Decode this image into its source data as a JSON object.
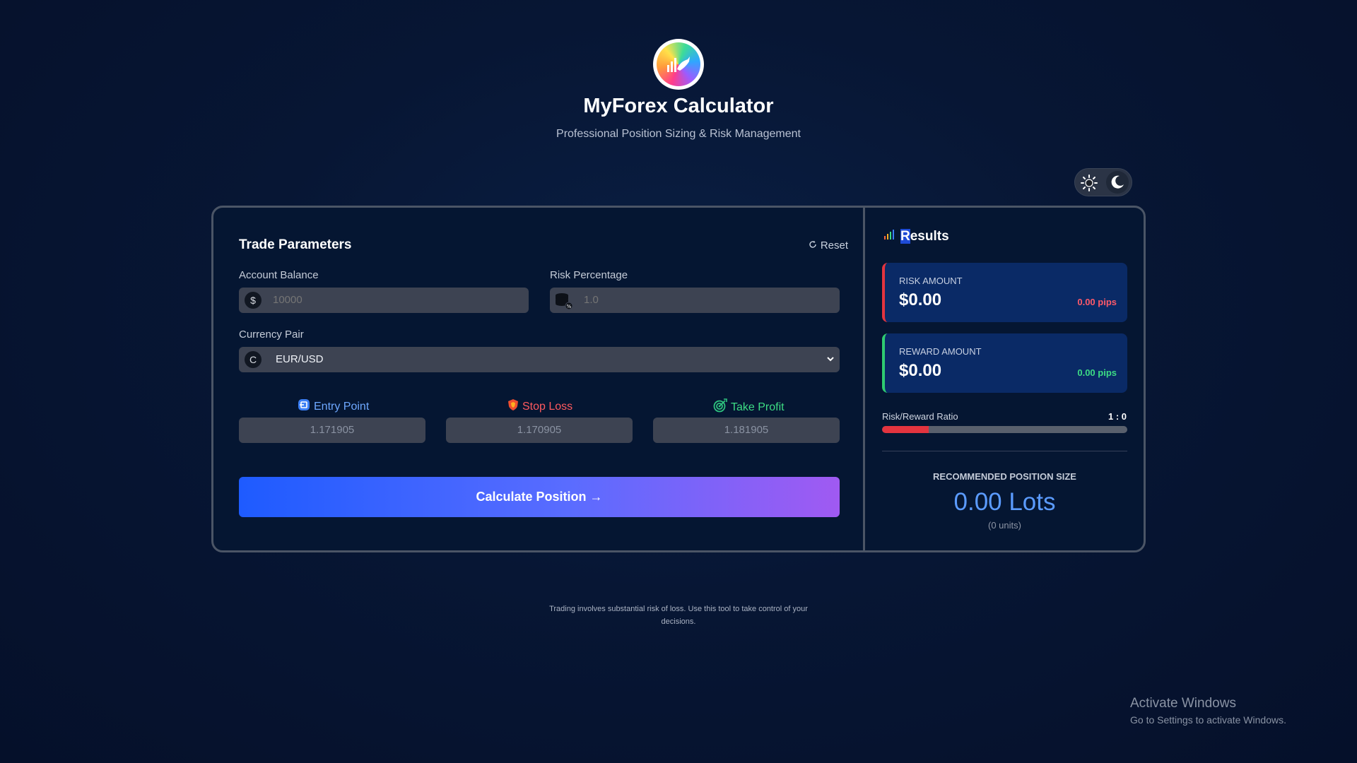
{
  "app": {
    "title": "MyForex Calculator",
    "subtitle": "Professional Position Sizing & Risk Management",
    "logo_icon": "bull-chart-logo"
  },
  "theme_toggle": {
    "light_icon": "sun-icon",
    "dark_icon": "moon-icon",
    "mode": "dark"
  },
  "trade_parameters": {
    "title": "Trade Parameters",
    "reset_label": "Reset",
    "account_balance": {
      "label": "Account Balance",
      "placeholder": "10000",
      "icon": "dollar-icon"
    },
    "risk_percentage": {
      "label": "Risk Percentage",
      "placeholder": "1.0",
      "icon": "coins-icon"
    },
    "currency_pair": {
      "label": "Currency Pair",
      "selected": "EUR/USD",
      "icon": "currency-icon"
    },
    "entry_point": {
      "label": "Entry Point",
      "placeholder": "1.171905",
      "color": "#6ea8ff"
    },
    "stop_loss": {
      "label": "Stop Loss",
      "placeholder": "1.170905",
      "color": "#ff5a5f"
    },
    "take_profit": {
      "label": "Take Profit",
      "placeholder": "1.181905",
      "color": "#3ddc84"
    },
    "calculate_label": "Calculate Position →"
  },
  "results": {
    "title": "Results",
    "risk": {
      "caption": "RISK AMOUNT",
      "amount": "$0.00",
      "pips": "0.00 pips",
      "color": "#e3343f"
    },
    "reward": {
      "caption": "REWARD AMOUNT",
      "amount": "$0.00",
      "pips": "0.00 pips",
      "color": "#2ecc71"
    },
    "ratio": {
      "label": "Risk/Reward Ratio",
      "value": "1 : 0",
      "risk_fraction": 0.19
    },
    "recommended": {
      "caption": "RECOMMENDED POSITION SIZE",
      "lots": "0.00 Lots",
      "units": "(0 units)"
    }
  },
  "disclaimer": "Trading involves substantial risk of loss. Use this tool to take control of your decisions.",
  "windows_watermark": {
    "title": "Activate Windows",
    "subtitle": "Go to Settings to activate Windows."
  }
}
